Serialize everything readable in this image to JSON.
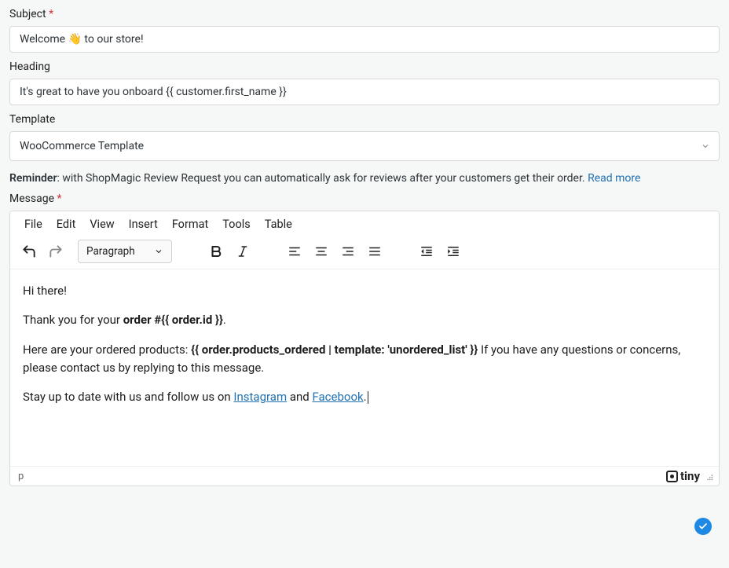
{
  "fields": {
    "subject": {
      "label": "Subject",
      "required": "*",
      "value": "Welcome 👋 to our store!"
    },
    "heading": {
      "label": "Heading",
      "value": "It's great to have you onboard {{ customer.first_name }}"
    },
    "template": {
      "label": "Template",
      "selected": "WooCommerce Template"
    },
    "message": {
      "label": "Message",
      "required": "*"
    }
  },
  "reminder": {
    "label": "Reminder",
    "text": ": with ShopMagic Review Request you can automatically ask for reviews after your customers get their order. ",
    "link_text": "Read more"
  },
  "editor_menu": {
    "file": "File",
    "edit": "Edit",
    "view": "View",
    "insert": "Insert",
    "format": "Format",
    "tools": "Tools",
    "table": "Table"
  },
  "toolbar": {
    "format_selector": "Paragraph"
  },
  "message_body": {
    "p1": "Hi there!",
    "p2_a": "Thank you for your ",
    "p2_b": "order #{{ order.id }}",
    "p2_c": ".",
    "p3_a": "Here are your ordered products: ",
    "p3_b": "{{ order.products_ordered | template: 'unordered_list' }}",
    "p3_c": " If you have any questions or concerns, please contact us by replying to this message.",
    "p4_a": "Stay up to date with us and follow us on ",
    "p4_link1": "Instagram",
    "p4_b": " and ",
    "p4_link2": "Facebook",
    "p4_c": "."
  },
  "statusbar": {
    "path": "p",
    "brand": "tiny"
  }
}
